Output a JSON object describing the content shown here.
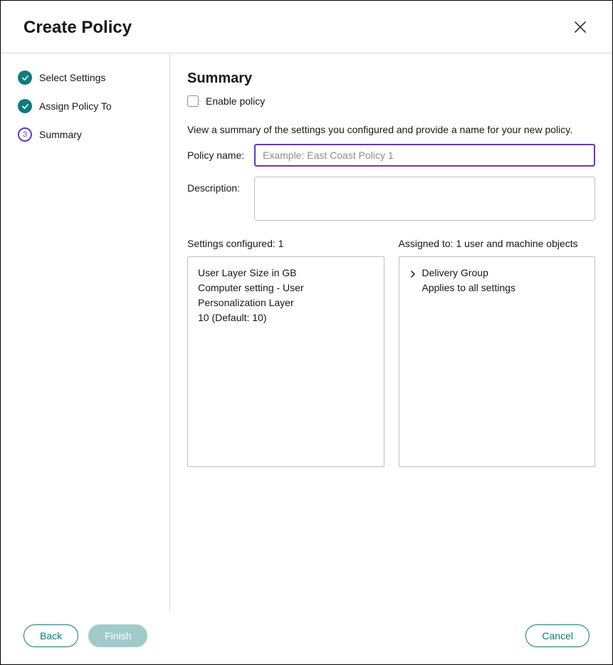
{
  "header": {
    "title": "Create Policy"
  },
  "steps": [
    {
      "label": "Select Settings",
      "state": "done"
    },
    {
      "label": "Assign Policy To",
      "state": "done"
    },
    {
      "label": "Summary",
      "state": "current",
      "number": "3"
    }
  ],
  "main": {
    "title": "Summary",
    "enable_label": "Enable policy",
    "helper": "View a summary of the settings you configured and provide a name for your new policy.",
    "policy_name_label": "Policy name:",
    "policy_name_value": "",
    "policy_name_placeholder": "Example: East Coast Policy 1",
    "description_label": "Description:",
    "description_value": ""
  },
  "settings_panel": {
    "header": "Settings configured: 1",
    "item": {
      "name": "User Layer Size in GB",
      "category": "Computer setting - User Personalization Layer",
      "value": "10 (Default: 10)"
    }
  },
  "assigned_panel": {
    "header": "Assigned to: 1 user and machine objects",
    "item": {
      "title": "Delivery Group",
      "scope": "Applies to all settings"
    }
  },
  "footer": {
    "back": "Back",
    "finish": "Finish",
    "cancel": "Cancel"
  }
}
